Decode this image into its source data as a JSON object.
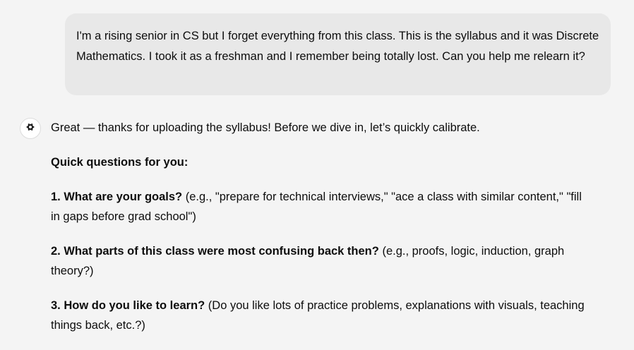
{
  "user_message": {
    "text": "I'm a rising senior in CS but I forget everything from this class. This is the syllabus and it was Discrete Mathematics. I took it as a freshman and I remember being totally lost. Can you help me relearn it?"
  },
  "assistant": {
    "avatar_icon": "openai-logo-icon",
    "intro": "Great — thanks for uploading the syllabus! Before we dive in, let’s quickly calibrate.",
    "questions_heading": "Quick questions for you:",
    "questions": [
      {
        "bold": "1. What are your goals?",
        "rest": " (e.g., \"prepare for technical interviews,\" \"ace a class with similar content,\" \"fill in gaps before grad school\")"
      },
      {
        "bold": "2. What parts of this class were most confusing back then?",
        "rest": " (e.g., proofs, logic, induction, graph theory?)"
      },
      {
        "bold": "3. How do you like to learn?",
        "rest": " (Do you like lots of practice problems, explanations with visuals, teaching things back, etc.?)"
      }
    ]
  }
}
